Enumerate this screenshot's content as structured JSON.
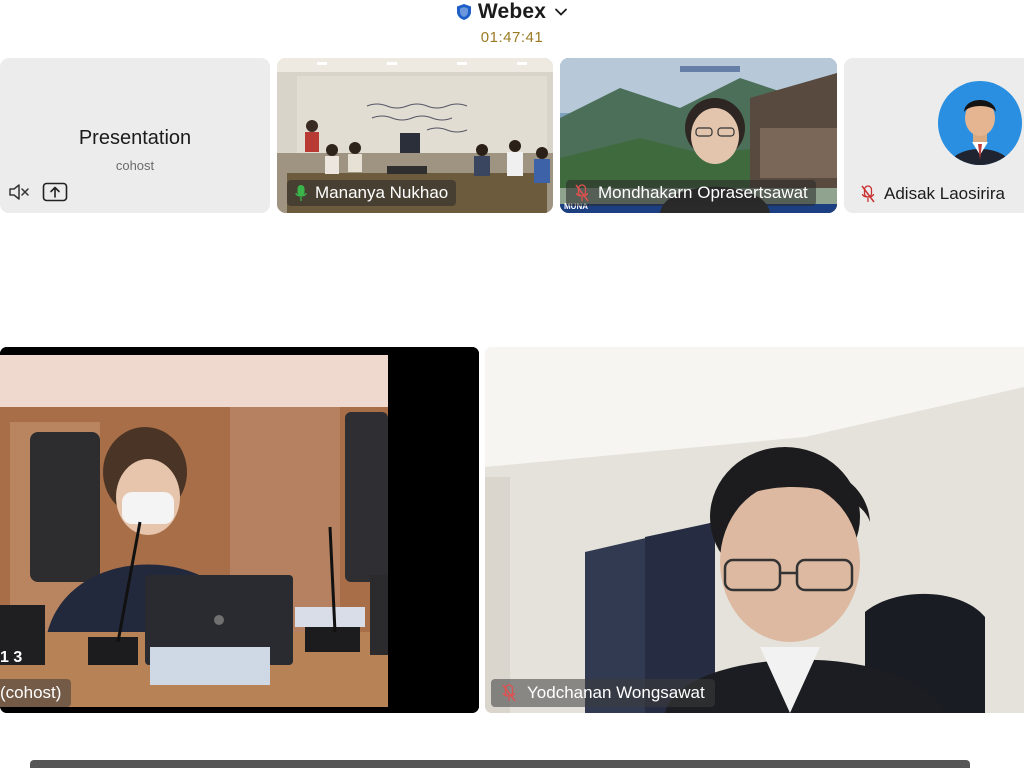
{
  "header": {
    "app_title": "Webex",
    "timer": "01:47:41",
    "accent_color": "#1d5ec8",
    "timer_color": "#9a7a21"
  },
  "thumbnails": [
    {
      "kind": "presentation",
      "title": "Presentation",
      "subtitle": "cohost",
      "icons": [
        "mute-x-icon",
        "share-upload-icon"
      ]
    },
    {
      "kind": "video",
      "name": "Mananya Nukhao",
      "mic": "mic-active-icon"
    },
    {
      "kind": "video",
      "name": "Mondhakarn Oprasertsawat",
      "mic": "mic-muted-icon",
      "sign_fragment": "MUNA"
    },
    {
      "kind": "avatar",
      "name": "Adisak Laosirira",
      "mic": "mic-muted-icon"
    }
  ],
  "main_tiles": [
    {
      "name": "(cohost)",
      "desk_sign": "1 3"
    },
    {
      "name": "Yodchanan Wongsawat",
      "mic": "mic-muted-icon"
    }
  ]
}
